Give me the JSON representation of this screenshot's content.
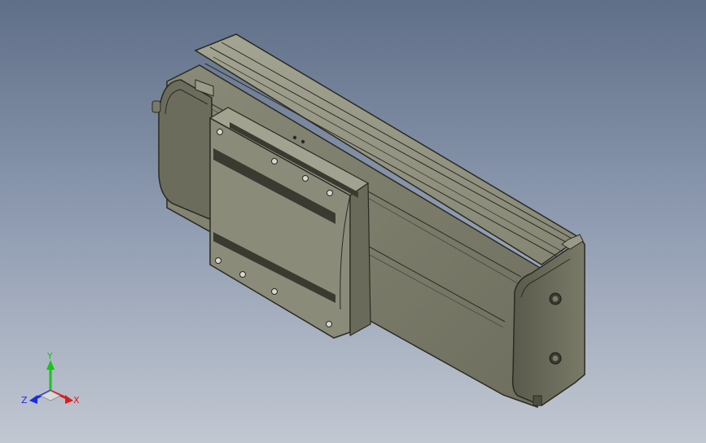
{
  "viewport": {
    "background_top": "#5f6f87",
    "background_bottom": "#c2c8d2"
  },
  "model": {
    "body_color": "#7d7d6c",
    "edge_color": "#2a2a22",
    "carriage_color": "#8b8b7a"
  },
  "triad": {
    "y_label": "Y",
    "x_label": "X",
    "z_label": "Z",
    "y_color": "#19c419",
    "x_color": "#e01b1b",
    "z_color": "#1b2be0"
  }
}
